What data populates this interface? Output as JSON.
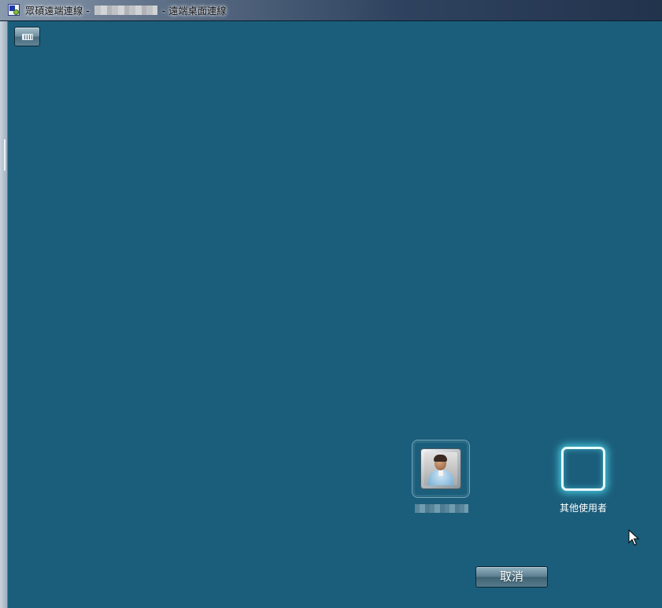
{
  "window": {
    "title_prefix": "眾碩遠端連線 -",
    "title_suffix": "- 遠端桌面連線"
  },
  "toolbar": {
    "keyboard_icon": "keyboard-icon"
  },
  "users": [
    {
      "type": "user",
      "icon": "user-avatar-icon"
    },
    {
      "type": "other",
      "label": "其他使用者"
    }
  ],
  "actions": {
    "cancel_label": "取消"
  },
  "colors": {
    "background": "#1b5e7b",
    "tile_glow": "#50d7eb"
  }
}
